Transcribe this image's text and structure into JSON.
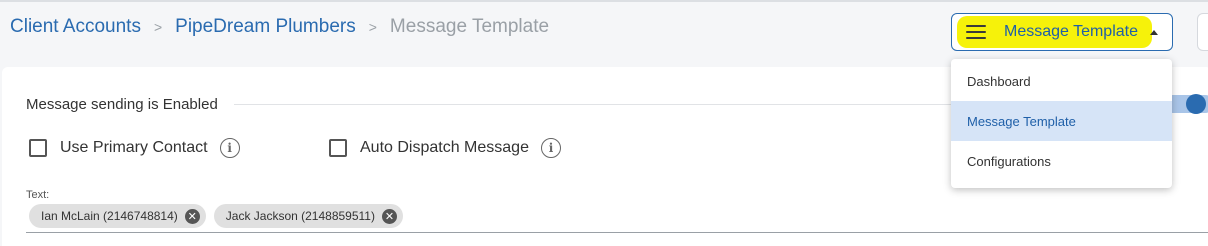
{
  "breadcrumb": {
    "items": [
      "Client Accounts",
      "PipeDream Plumbers"
    ],
    "current": "Message Template",
    "separator": ">"
  },
  "menu": {
    "label": "Message Template",
    "items": [
      {
        "label": "Dashboard",
        "selected": false
      },
      {
        "label": "Message Template",
        "selected": true
      },
      {
        "label": "Configurations",
        "selected": false
      }
    ]
  },
  "settings": {
    "sending_label": "Message sending is Enabled",
    "sending_enabled": true,
    "use_primary_contact": {
      "label": "Use Primary Contact",
      "checked": false
    },
    "auto_dispatch": {
      "label": "Auto Dispatch Message",
      "checked": false
    }
  },
  "recipients": {
    "label": "Text:",
    "chips": [
      "Ian McLain (2146748814)",
      "Jack Jackson (2148859511)"
    ]
  },
  "colors": {
    "accent": "#2a6bb0",
    "highlight": "#f6f20a",
    "selected_bg": "#d6e4f7"
  }
}
